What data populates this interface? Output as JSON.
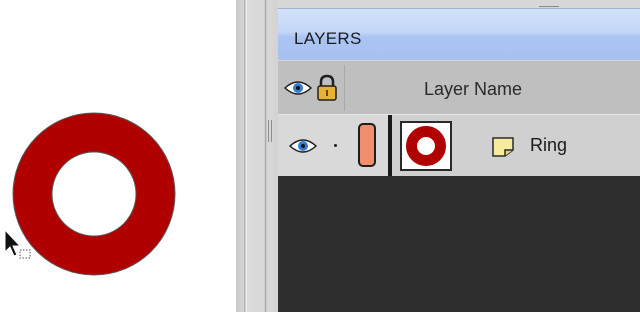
{
  "panel": {
    "title": "LAYERS",
    "columns": {
      "visibility_icon": "eye-icon",
      "lock_icon": "lock-icon",
      "name_header": "Layer Name"
    },
    "layers": [
      {
        "name": "Ring",
        "visible": true,
        "color": "#f08e6e",
        "type_icon": "sticky-note-icon",
        "thumbnail": "red-ring"
      }
    ]
  },
  "canvas": {
    "shape": "ring",
    "fill": "#b00000",
    "stroke": "#5a5a5a"
  },
  "colors": {
    "title_bar": "#b7cff5",
    "header_row": "#bfbfbf",
    "panel_background": "#2f2f2f",
    "ring_red": "#b00000"
  }
}
